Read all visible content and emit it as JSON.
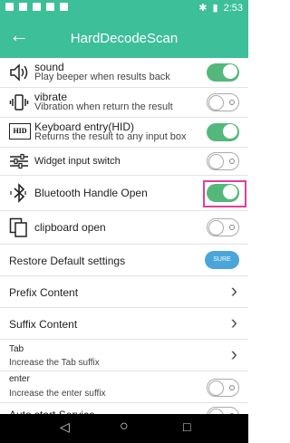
{
  "status": {
    "time": "2:53"
  },
  "appbar": {
    "title": "HardDecodeScan",
    "back_icon": "arrow-left-icon"
  },
  "colors": {
    "accent": "#3dbf99",
    "toggle_on": "#53b87a",
    "sure_btn": "#4aa6d8",
    "highlight": "#e0409a"
  },
  "settings": [
    {
      "label": "sound",
      "sub": "Play beeper when results back",
      "control": "toggle",
      "state": "on",
      "icon": "speaker-icon"
    },
    {
      "label": "vibrate",
      "sub": "Vibration when return the result",
      "control": "toggle",
      "state": "off",
      "icon": "vibrate-icon"
    },
    {
      "label": "Keyboard entry(HID)",
      "sub": "Returns the result to any input box",
      "control": "toggle",
      "state": "on",
      "icon": "hid-icon",
      "icon_text": "HID"
    },
    {
      "label": "Widget input switch",
      "sub": "",
      "control": "toggle",
      "state": "off",
      "icon": "sliders-icon"
    },
    {
      "label": "Bluetooth Handle Open",
      "sub": "",
      "control": "toggle",
      "state": "on",
      "icon": "bluetooth-icon",
      "highlighted": true
    },
    {
      "label": "clipboard open",
      "sub": "",
      "control": "toggle",
      "state": "off",
      "icon": "clipboard-icon"
    },
    {
      "label": "Restore Default settings",
      "sub": "",
      "control": "button",
      "button_label": "SURE"
    },
    {
      "label": "Prefix Content",
      "sub": "",
      "control": "chevron"
    },
    {
      "label": "Suffix Content",
      "sub": "",
      "control": "chevron"
    },
    {
      "label": "Tab",
      "sub": "Increase the Tab suffix",
      "control": "chevron"
    },
    {
      "label": "enter",
      "sub": "Increase the enter suffix",
      "control": "toggle",
      "state": "off"
    },
    {
      "label": "Auto start Service",
      "sub": "",
      "control": "toggle",
      "state": "off"
    }
  ],
  "navbar": {
    "back": "◁",
    "home": "○",
    "recents": "□"
  }
}
